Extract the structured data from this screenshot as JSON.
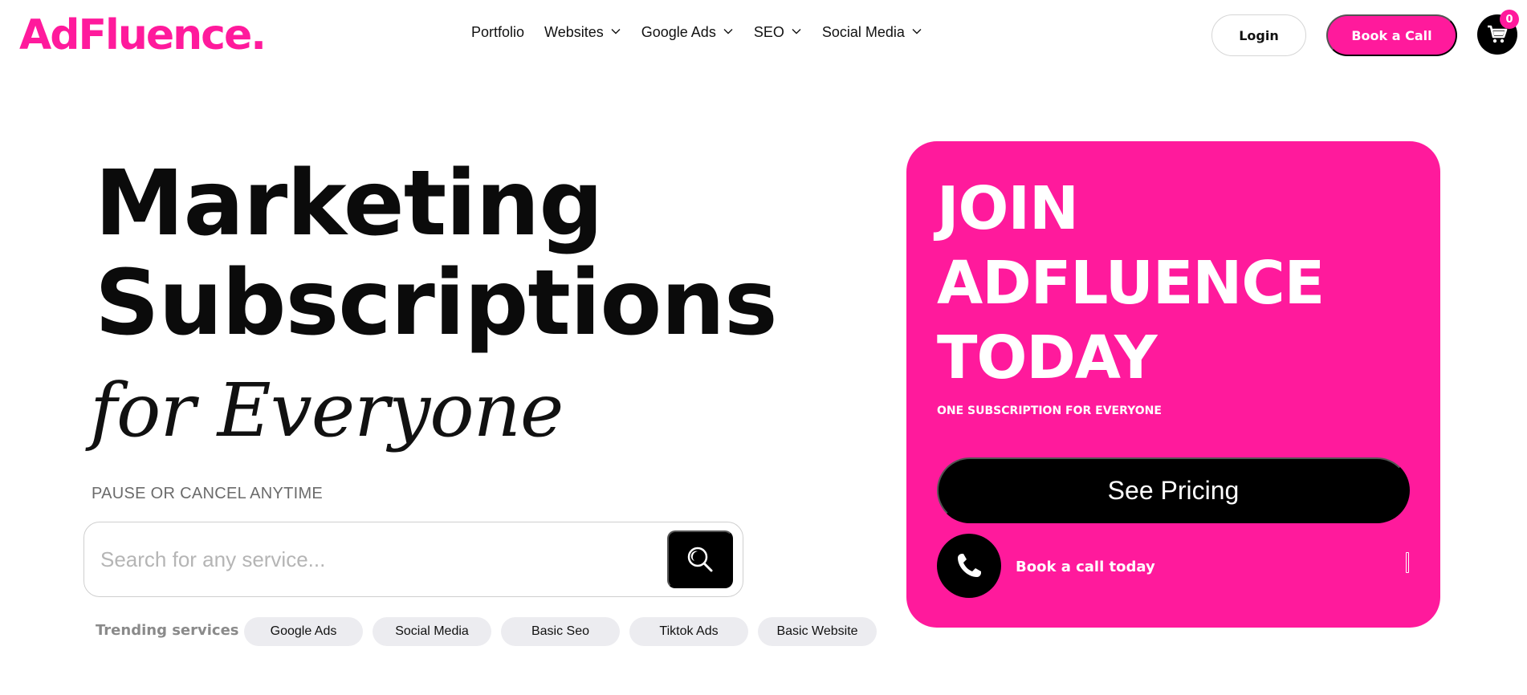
{
  "brand": {
    "logo_text": "AdFluence.",
    "accent_color": "#ff1a9c"
  },
  "nav": {
    "items": [
      {
        "label": "Portfolio",
        "has_dropdown": false
      },
      {
        "label": "Websites",
        "has_dropdown": true
      },
      {
        "label": "Google Ads",
        "has_dropdown": true
      },
      {
        "label": "SEO",
        "has_dropdown": true
      },
      {
        "label": "Social Media",
        "has_dropdown": true
      }
    ]
  },
  "header": {
    "login_label": "Login",
    "book_call_label": "Book a Call",
    "cart_count": "0",
    "cart_icon": "cart-icon"
  },
  "hero": {
    "title_line1": "Marketing",
    "title_line2": "Subscriptions",
    "script_line": "for Everyone",
    "tagline": "PAUSE OR CANCEL ANYTIME"
  },
  "search": {
    "placeholder": "Search for any service...",
    "value": "",
    "button_icon": "search-icon"
  },
  "trending": {
    "label": "Trending services",
    "chips": [
      "Google Ads",
      "Social Media",
      "Basic Seo",
      "Tiktok Ads",
      "Basic Website"
    ]
  },
  "promo": {
    "title_line1": "JOIN",
    "title_line2": "ADFLUENCE",
    "title_line3": "TODAY",
    "subtitle": "ONE SUBSCRIPTION FOR EVERYONE",
    "pricing_label": "See Pricing",
    "call_label": "Book a call today",
    "call_icon": "phone-icon"
  }
}
